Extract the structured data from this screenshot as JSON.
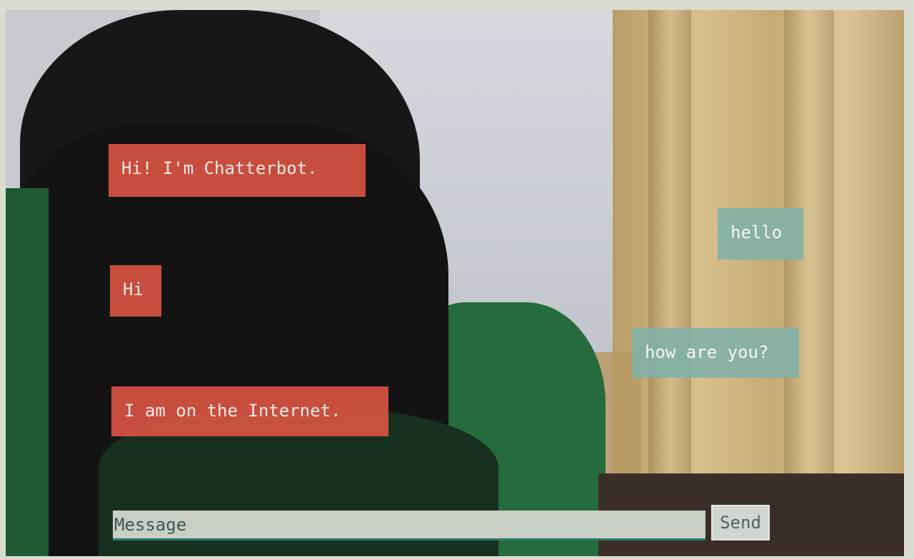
{
  "chat": {
    "messages": [
      {
        "sender": "bot",
        "text": "Hi! I'm Chatterbot."
      },
      {
        "sender": "bot",
        "text": "Hi"
      },
      {
        "sender": "bot",
        "text": "I am on the Internet."
      },
      {
        "sender": "user",
        "text": "hello"
      },
      {
        "sender": "user",
        "text": "how are you?"
      }
    ]
  },
  "composer": {
    "placeholder": "Message",
    "value": "",
    "send_label": "Send"
  },
  "colors": {
    "bot_bubble": "#d75442",
    "user_bubble": "#80b2a8",
    "input_underline": "#2a7a6a"
  }
}
